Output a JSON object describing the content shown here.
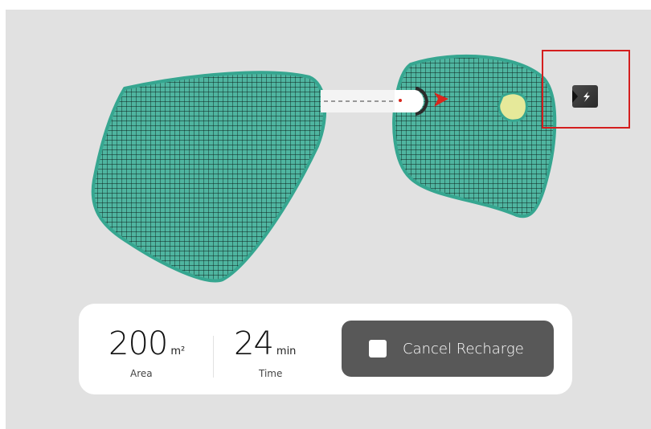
{
  "app": {
    "screen": "recharge-map"
  },
  "stats": {
    "area": {
      "value": "200",
      "unit": "m²",
      "label": "Area"
    },
    "time": {
      "value": "24",
      "unit": "min",
      "label": "Time"
    }
  },
  "actions": {
    "cancel_recharge_label": "Cancel Recharge"
  },
  "colors": {
    "lawn_fill": "#4fb5a0",
    "lawn_border": "#36a690",
    "grid_line": "#0b1f1a",
    "obstacle": "#e6e99a",
    "robot_arrow": "#d8271d",
    "highlight_box": "#d41e1e",
    "button_bg": "#585858",
    "panel_bg": "#ffffff",
    "map_bg": "#e1e1e1"
  },
  "icons": {
    "charging_station": "lightning-bolt-icon",
    "robot_direction": "arrow-right-icon",
    "stop": "stop-square-icon"
  }
}
